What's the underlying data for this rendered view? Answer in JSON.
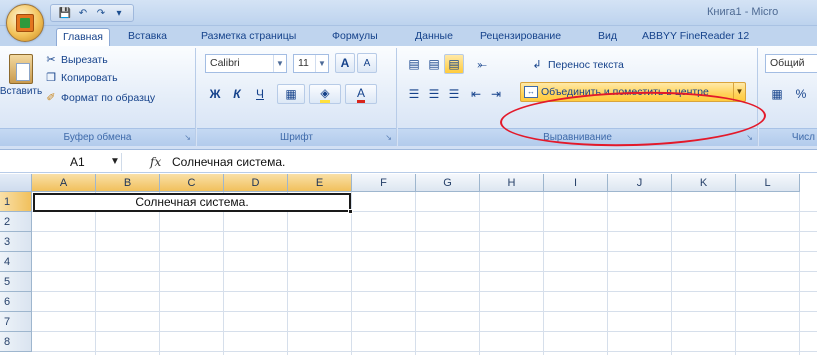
{
  "title_bar": {
    "app_title": "Книга1 - Micro",
    "qat": [
      "save-icon",
      "undo-icon",
      "redo-icon",
      "dropdown-icon"
    ]
  },
  "tabs": [
    {
      "label": "Главная",
      "active": true
    },
    {
      "label": "Вставка"
    },
    {
      "label": "Разметка страницы"
    },
    {
      "label": "Формулы"
    },
    {
      "label": "Данные"
    },
    {
      "label": "Рецензирование"
    },
    {
      "label": "Вид"
    },
    {
      "label": "ABBYY FineReader 12"
    }
  ],
  "clipboard": {
    "paste_label": "Вставить",
    "cut_label": "Вырезать",
    "copy_label": "Копировать",
    "format_painter_label": "Формат по образцу",
    "group_label": "Буфер обмена"
  },
  "font": {
    "font_name": "Calibri",
    "font_size": "11",
    "bold": "Ж",
    "italic": "К",
    "underline": "Ч",
    "grow": "A",
    "shrink": "A",
    "group_label": "Шрифт"
  },
  "alignment": {
    "wrap_text_label": "Перенос текста",
    "merge_center_label": "Объединить и поместить в центре",
    "group_label": "Выравнивание"
  },
  "number": {
    "format_value": "Общий",
    "percent": "%",
    "group_label": "Числ"
  },
  "formula_bar": {
    "name_box": "A1",
    "fx": "fx",
    "formula": "Солнечная система."
  },
  "sheet": {
    "columns": [
      "A",
      "B",
      "C",
      "D",
      "E",
      "F",
      "G",
      "H",
      "I",
      "J",
      "K",
      "L"
    ],
    "selected_columns": [
      "A",
      "B",
      "C",
      "D",
      "E"
    ],
    "rows": [
      "1",
      "2",
      "3",
      "4",
      "5",
      "6",
      "7",
      "8"
    ],
    "selected_row": "1",
    "merged_cell_text": "Солнечная система."
  }
}
